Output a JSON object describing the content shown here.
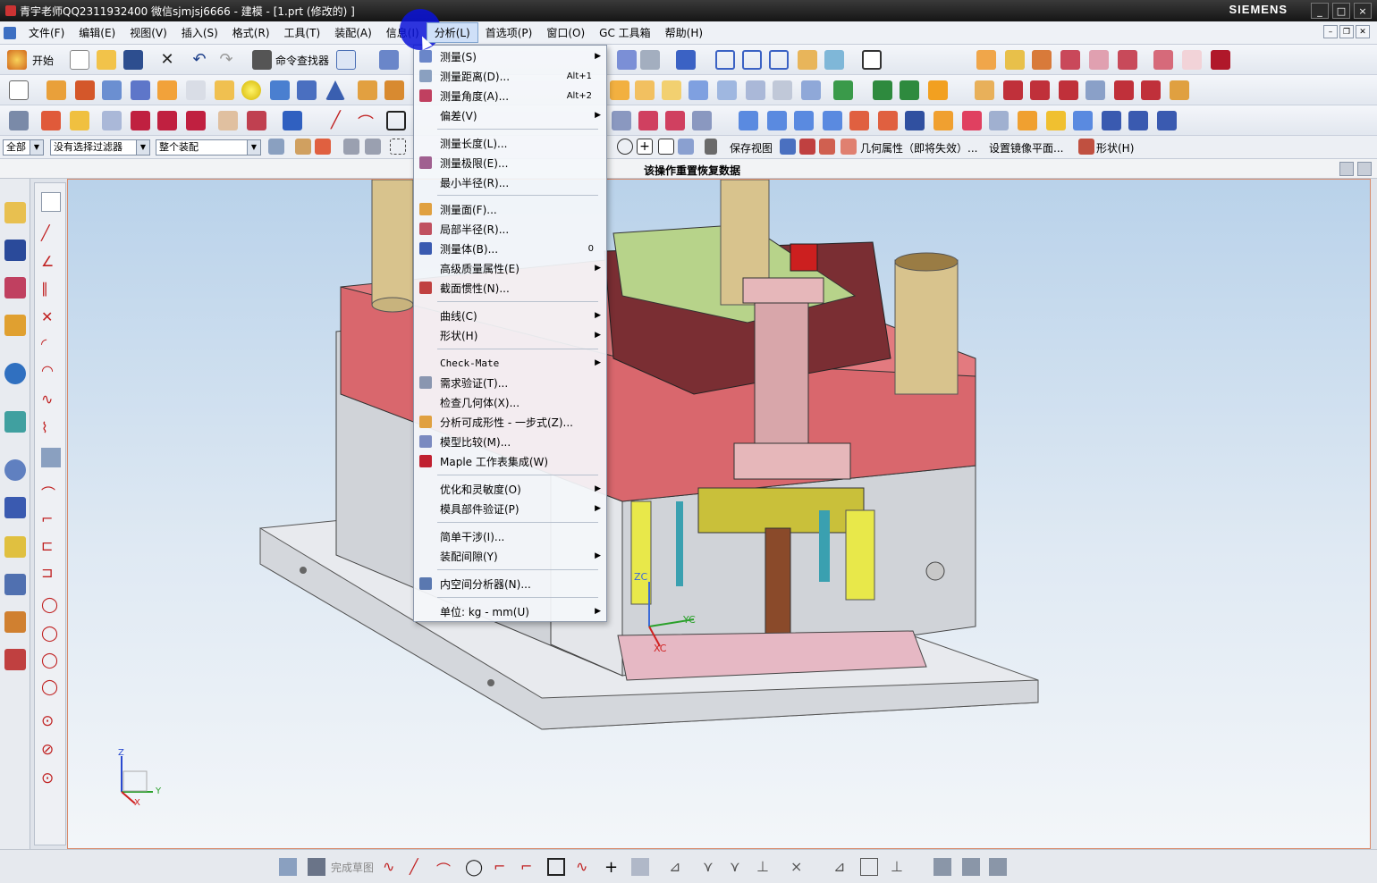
{
  "window": {
    "title": "青宇老师QQ2311932400 微信sjmjsj6666 - 建模 - [1.prt  (修改的) ]",
    "brand": "SIEMENS",
    "min": "_",
    "max": "□",
    "close": "×"
  },
  "menubar": {
    "items": [
      "文件(F)",
      "编辑(E)",
      "视图(V)",
      "插入(S)",
      "格式(R)",
      "工具(T)",
      "装配(A)",
      "信息(I)",
      "分析(L)",
      "首选项(P)",
      "窗口(O)",
      "GC 工具箱",
      "帮助(H)"
    ],
    "active": "分析(L)"
  },
  "toolbar1": {
    "start_label": "开始",
    "command_finder_label": "命令查找器"
  },
  "filterbar": {
    "type_filter": "全部",
    "selection_filter": "没有选择过滤器",
    "scope": "整个装配",
    "save_view": "保存视图",
    "geometry_props": "几何属性（即将失效）...",
    "mirror_plane": "设置镜像平面...",
    "shape": "形状(H)"
  },
  "status": {
    "message": "该操作重置恢复数据"
  },
  "analysis_menu": {
    "items": [
      {
        "label": "测量(S)",
        "submenu": true
      },
      {
        "label": "测量距离(D)...",
        "shortcut": "Alt+1"
      },
      {
        "label": "测量角度(A)...",
        "shortcut": "Alt+2"
      },
      {
        "label": "偏差(V)",
        "submenu": true
      },
      {
        "label": "测量长度(L)..."
      },
      {
        "label": "测量极限(E)..."
      },
      {
        "label": "最小半径(R)..."
      },
      {
        "label": "测量面(F)..."
      },
      {
        "label": "局部半径(R)..."
      },
      {
        "label": "测量体(B)...",
        "shortcut": "0"
      },
      {
        "label": "高级质量属性(E)",
        "submenu": true
      },
      {
        "label": "截面惯性(N)..."
      },
      {
        "label": "曲线(C)",
        "submenu": true
      },
      {
        "label": "形状(H)",
        "submenu": true
      },
      {
        "label": "Check-Mate",
        "submenu": true
      },
      {
        "label": "需求验证(T)..."
      },
      {
        "label": "检查几何体(X)..."
      },
      {
        "label": "分析可成形性 - 一步式(Z)..."
      },
      {
        "label": "模型比较(M)..."
      },
      {
        "label": "Maple 工作表集成(W)"
      },
      {
        "label": "优化和灵敏度(O)",
        "submenu": true
      },
      {
        "label": "模具部件验证(P)",
        "submenu": true
      },
      {
        "label": "简单干涉(I)..."
      },
      {
        "label": "装配间隙(Y)",
        "submenu": true
      },
      {
        "label": "内空间分析器(N)..."
      },
      {
        "label": "单位: kg - mm(U)",
        "submenu": true
      }
    ]
  },
  "bottombar": {
    "finish_sketch": "完成草图"
  },
  "viewport": {
    "axis_zc": "ZC",
    "axis_yc": "YC",
    "axis_xc": "XC",
    "triad_z": "Z",
    "triad_y": "Y",
    "triad_x": "X"
  }
}
